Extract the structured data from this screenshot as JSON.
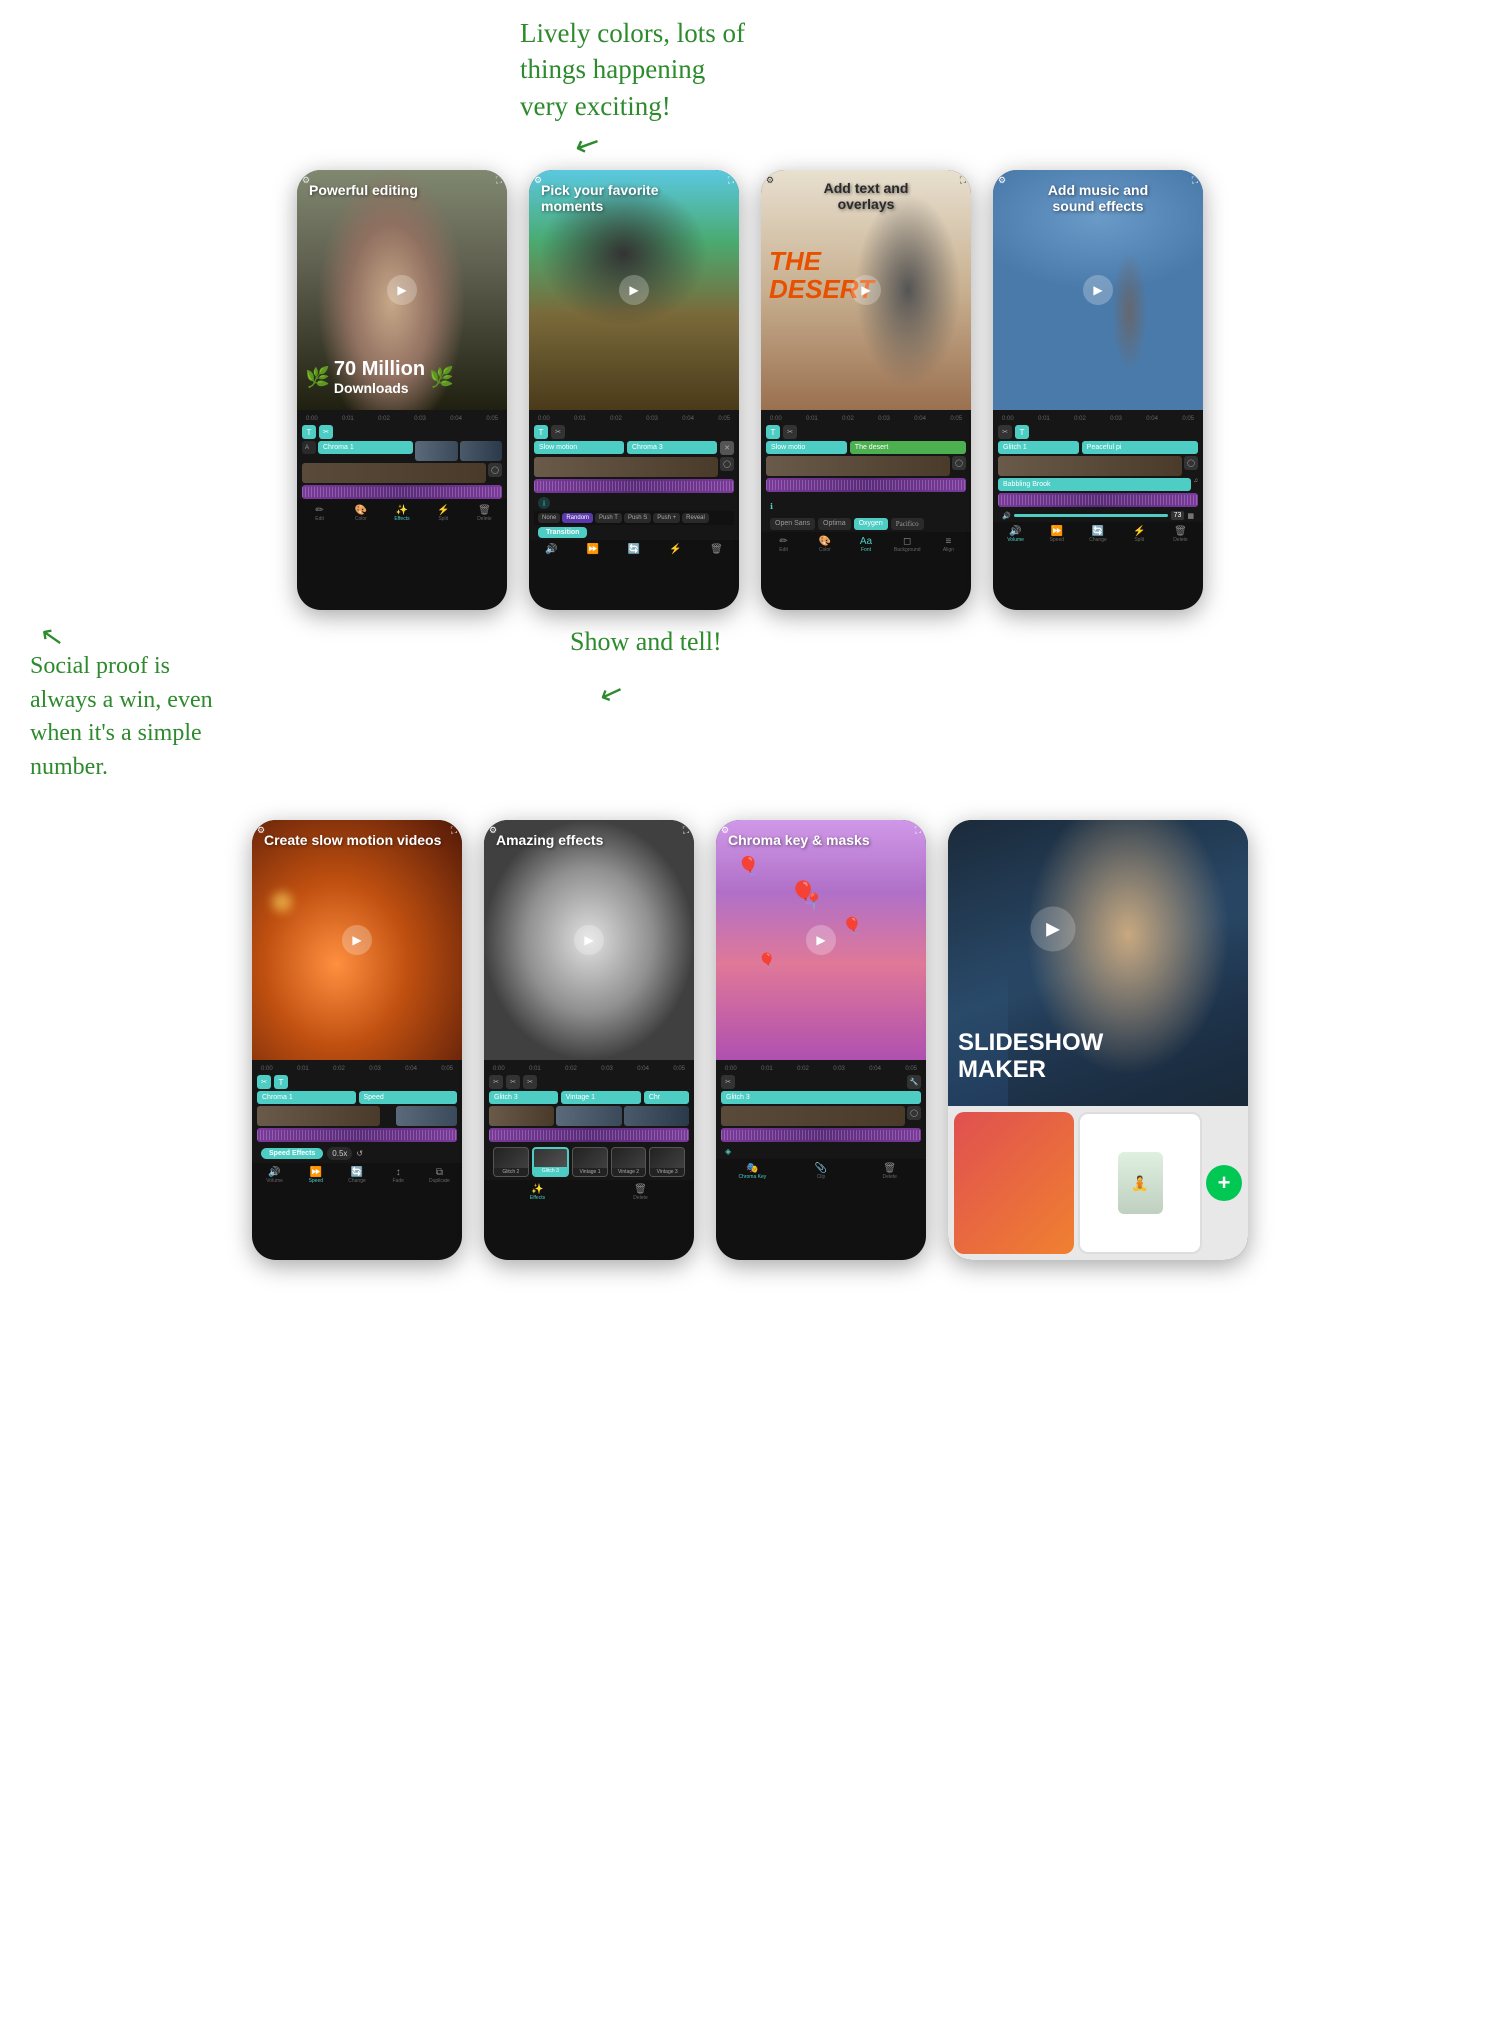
{
  "page": {
    "title": "Video Editor App Store Screenshots",
    "bg_color": "#ffffff"
  },
  "annotations": {
    "top": "Lively colors, lots of\nthings happening\nvery exciting!",
    "bottom_left": "Social proof is\nalways a win, even\nwhen it's a simple\nnumber.",
    "show_and_tell": "Show and tell!"
  },
  "row1": {
    "phone1": {
      "title": "Powerful editing",
      "badge_big": "70 Million",
      "badge_sub": "Downloads"
    },
    "phone2": {
      "title": "Pick your favorite moments",
      "chip1": "Slow motion",
      "chip2": "Chroma 3"
    },
    "phone3": {
      "title": "Add text and overlays",
      "desert_text": "THE\nDESERT",
      "chip1": "Slow motio",
      "chip2": "The desert"
    },
    "phone4": {
      "title": "Add music and sound effects",
      "chip1": "Glitch 1",
      "chip2": "Peaceful pi",
      "chip3": "Babbling Brook"
    }
  },
  "row2": {
    "phone5": {
      "title": "Create slow motion videos",
      "chip1": "Chroma 1",
      "chip2": "Speed",
      "speed_val": "0.5x"
    },
    "phone6": {
      "title": "Amazing effects",
      "chip1": "Glitch 3",
      "chip2": "Vintage 1",
      "chip3": "Chr"
    },
    "phone7": {
      "title": "Chroma key & masks",
      "chip1": "Glitch 3"
    },
    "phone8": {
      "title": "SLIDESHOW\nMAKER"
    }
  },
  "toolbar": {
    "phone2_bottom": [
      "None",
      "Random",
      "Push T",
      "Push S",
      "Push +",
      "Push +",
      "Reveal"
    ],
    "phone3_fonts": [
      "Open Sans",
      "Optima",
      "Oxygen",
      "Pacifico"
    ],
    "phone3_bottom": [
      "Edit",
      "Color",
      "Font",
      "Background",
      "Align"
    ],
    "phone4_bottom": [
      "Volume",
      "Speed",
      "Change",
      "Split",
      "Delete"
    ],
    "phone5_bottom": [
      "Volume",
      "Speed",
      "Change",
      "Fade",
      "Duplicate"
    ],
    "phone6_bottom": [
      "Effects",
      "Delete"
    ],
    "phone7_bottom": [
      "Chroma Key",
      "Clip",
      "Delete"
    ],
    "speed_items": [
      "Glitch 2",
      "Glitch 3",
      "Vintage 1",
      "Vintage 2",
      "Vintage 3"
    ]
  }
}
